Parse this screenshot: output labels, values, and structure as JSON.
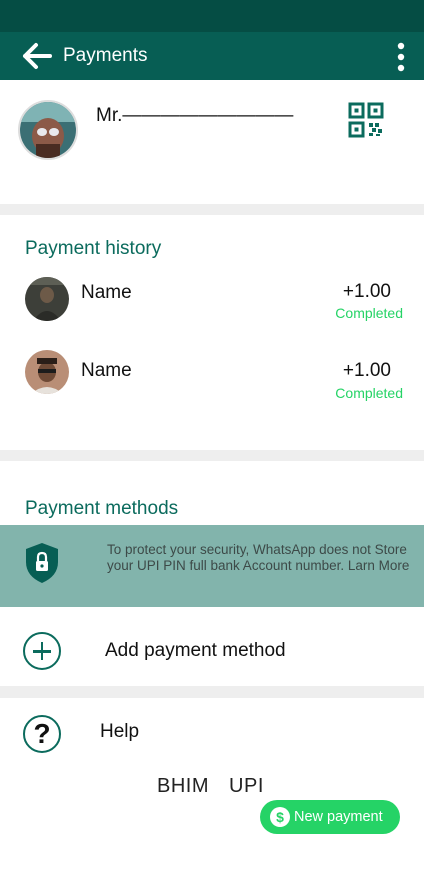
{
  "app_bar": {
    "title": "Payments"
  },
  "profile": {
    "name": "Mr.—————————"
  },
  "payment_history": {
    "title": "Payment history",
    "items": [
      {
        "name": "Name",
        "amount": "+1.00",
        "status": "Completed"
      },
      {
        "name": "Name",
        "amount": "+1.00",
        "status": "Completed"
      }
    ]
  },
  "payment_methods": {
    "title": "Payment methods",
    "security_notice": "To protect your security, WhatsApp does not Store your UPI PIN full bank Account number. Larn More",
    "add_label": "Add payment method"
  },
  "help": {
    "label": "Help"
  },
  "footer": {
    "brand": "BHIM UPI"
  },
  "fab": {
    "label": "New payment"
  },
  "colors": {
    "status_bar": "#054d44",
    "app_bar": "#075e54",
    "accent_text": "#0b6b5d",
    "completed": "#25d366",
    "banner": "#82b4ac",
    "divider": "#eeeeee"
  },
  "icons": [
    "back-arrow-icon",
    "more-vert-icon",
    "qr-code-icon",
    "shield-lock-icon",
    "plus-circle-icon",
    "help-circle-icon",
    "dollar-icon"
  ]
}
